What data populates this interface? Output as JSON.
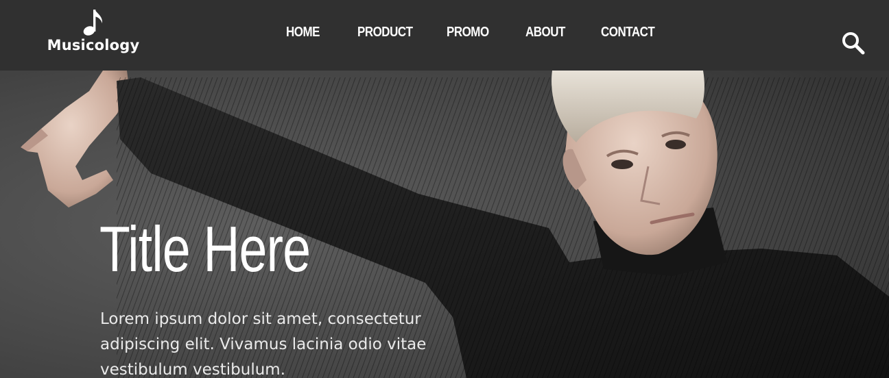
{
  "brand": {
    "name": "Musicology",
    "icon": "music-note-icon"
  },
  "nav": {
    "items": [
      {
        "label": "HOME"
      },
      {
        "label": "PRODUCT"
      },
      {
        "label": "PROMO"
      },
      {
        "label": "ABOUT"
      },
      {
        "label": "CONTACT"
      }
    ],
    "search_icon": "search-icon"
  },
  "hero": {
    "title": "Title Here",
    "text": "Lorem ipsum dolor sit amet, consectetur adipiscing elit. Vivamus lacinia odio vitae vestibulum vestibulum.",
    "image": "young man in black ribbed turtleneck with arm outstretched against dark concrete wall"
  },
  "colors": {
    "navbar": "#303030",
    "text": "#ffffff",
    "hero_background": "#4a4a4a"
  }
}
